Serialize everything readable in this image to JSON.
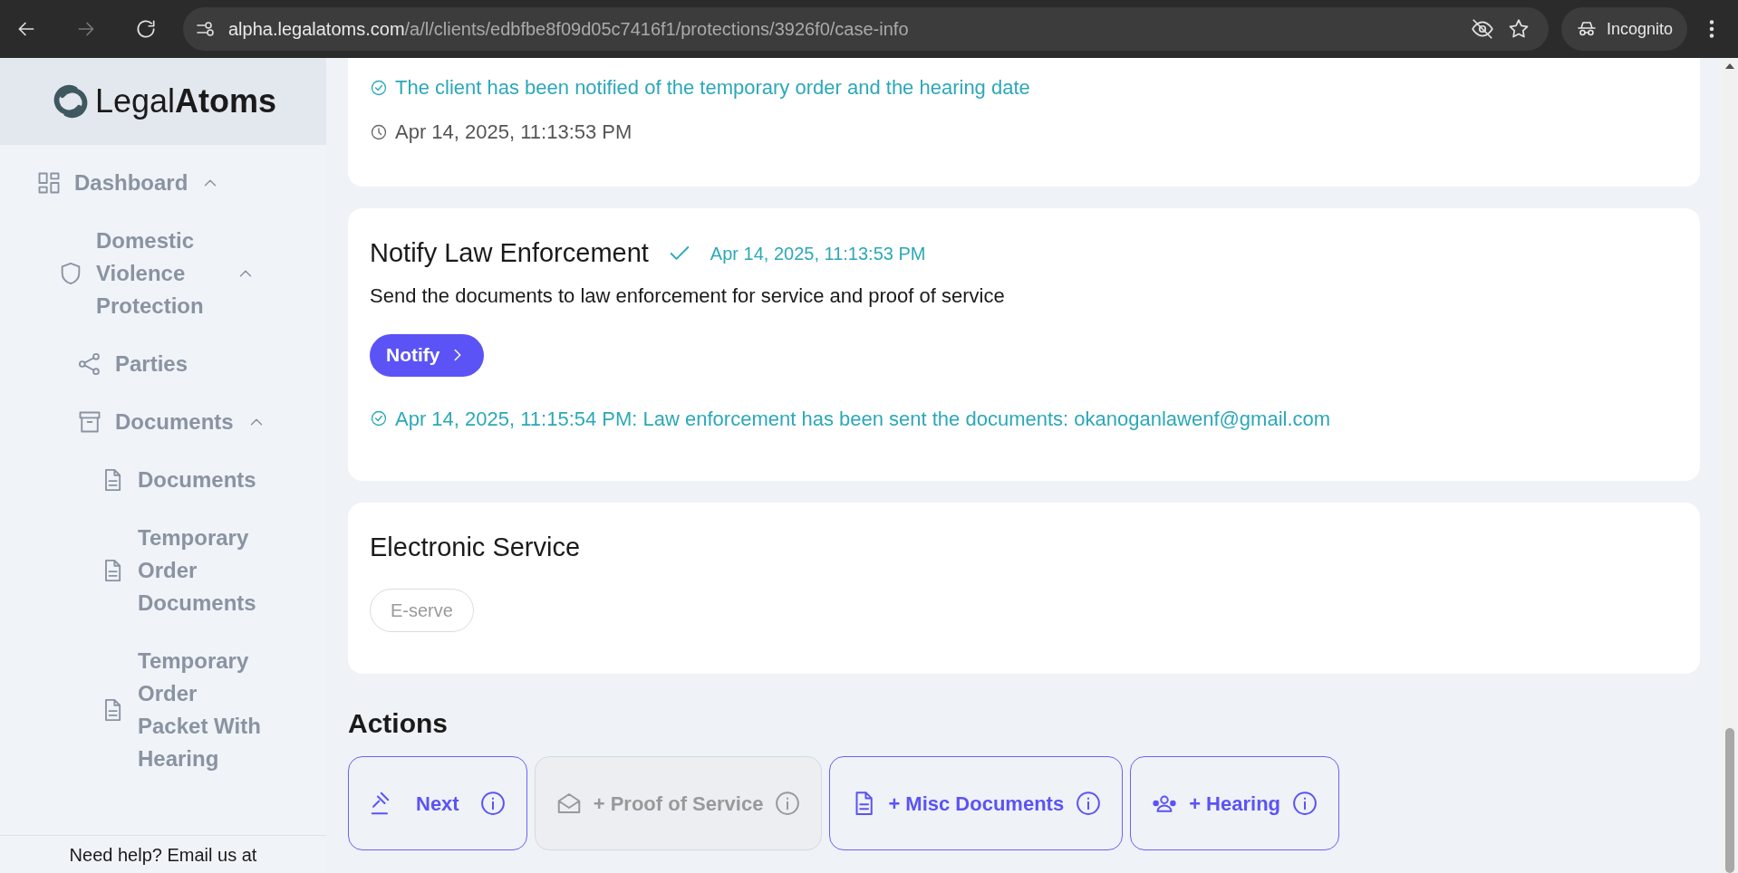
{
  "browser": {
    "url_host": "alpha.legalatoms.com",
    "url_path": "/a/l/clients/edbfbe8f09d05c7416f1/protections/3926f0/case-info",
    "profile": "Incognito"
  },
  "sidebar": {
    "logo": {
      "light": "Legal",
      "bold": "Atoms"
    },
    "nav": [
      {
        "label": "Dashboard",
        "kind": "dashboard",
        "expanded": true,
        "children": [
          {
            "label": "Domestic Violence Protection",
            "kind": "shield",
            "expanded": true,
            "children": [
              {
                "label": "Parties",
                "kind": "share"
              },
              {
                "label": "Documents",
                "kind": "archive",
                "expanded": true,
                "children": [
                  {
                    "label": "Documents",
                    "kind": "document"
                  },
                  {
                    "label": "Temporary Order Documents",
                    "kind": "document"
                  },
                  {
                    "label": "Temporary Order Packet With Hearing",
                    "kind": "document"
                  }
                ]
              }
            ]
          }
        ]
      }
    ],
    "help": "Need help? Email us at"
  },
  "cards": [
    {
      "kind": "status",
      "note": "The client has been notified of the temporary order and the hearing date",
      "time": "Apr 14, 2025, 11:13:53 PM"
    },
    {
      "kind": "task",
      "title": "Notify Law Enforcement",
      "completed": true,
      "completed_time": "Apr 14, 2025, 11:13:53 PM",
      "description": "Send the documents to law enforcement for service and proof of service",
      "button": "Notify",
      "log": "Apr 14, 2025, 11:15:54 PM: Law enforcement has been sent the documents: okanoganlawenf@gmail.com"
    },
    {
      "kind": "service",
      "title": "Electronic Service",
      "button": "E-serve",
      "button_disabled": true
    }
  ],
  "actions": {
    "title": "Actions",
    "buttons": [
      {
        "label": "Next",
        "kind": "gavel",
        "disabled": false
      },
      {
        "label": "+ Proof of Service",
        "kind": "envelope",
        "disabled": true
      },
      {
        "label": "+ Misc Documents",
        "kind": "document",
        "disabled": false
      },
      {
        "label": "+ Hearing",
        "kind": "people",
        "disabled": false
      }
    ]
  }
}
